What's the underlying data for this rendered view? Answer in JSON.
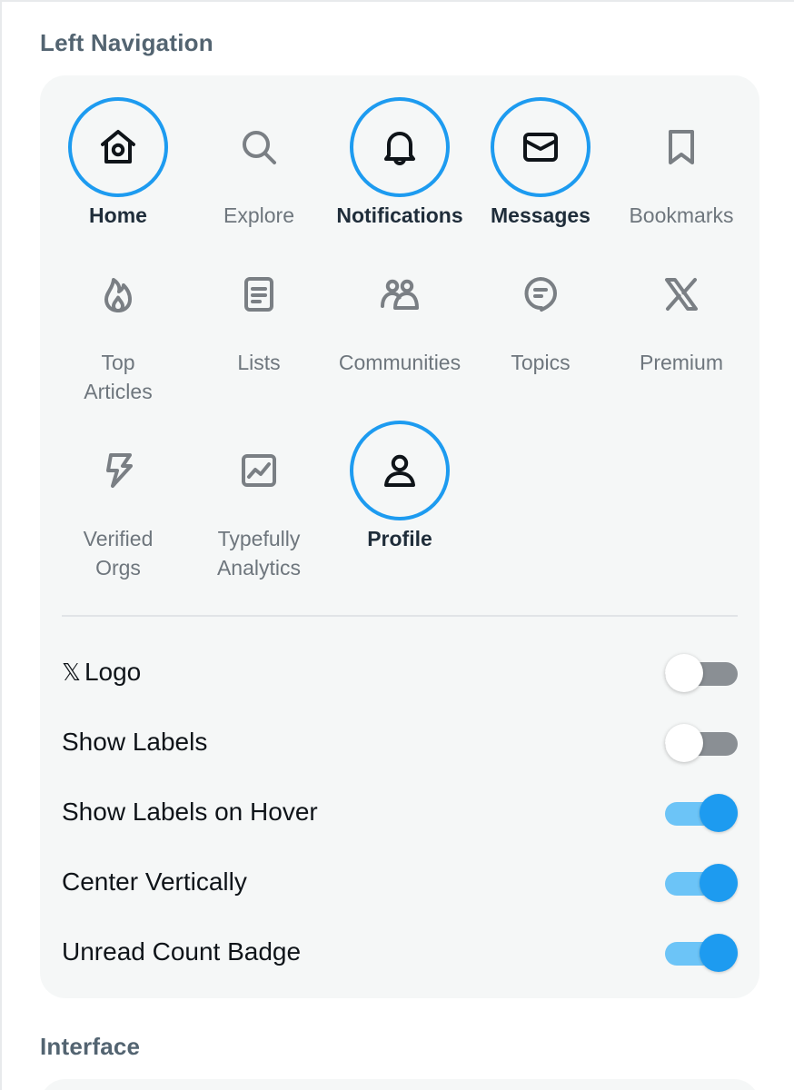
{
  "sections": {
    "left_navigation": "Left Navigation",
    "interface": "Interface"
  },
  "accent_color": "#1d9bf0",
  "nav_items": [
    {
      "label": "Home",
      "icon": "home-icon",
      "active": true
    },
    {
      "label": "Explore",
      "icon": "search-icon",
      "active": false
    },
    {
      "label": "Notifications",
      "icon": "bell-icon",
      "active": true
    },
    {
      "label": "Messages",
      "icon": "envelope-icon",
      "active": true
    },
    {
      "label": "Bookmarks",
      "icon": "bookmark-icon",
      "active": false
    },
    {
      "label": "Top Articles",
      "icon": "flame-icon",
      "active": false
    },
    {
      "label": "Lists",
      "icon": "list-icon",
      "active": false
    },
    {
      "label": "Communities",
      "icon": "people-icon",
      "active": false
    },
    {
      "label": "Topics",
      "icon": "topic-bubble-icon",
      "active": false
    },
    {
      "label": "Premium",
      "icon": "x-logo-icon",
      "active": false
    },
    {
      "label": "Verified Orgs",
      "icon": "lightning-icon",
      "active": false
    },
    {
      "label": "Typefully Analytics",
      "icon": "chart-icon",
      "active": false
    },
    {
      "label": "Profile",
      "icon": "person-icon",
      "active": true
    }
  ],
  "settings": [
    {
      "label": "Logo",
      "prefix_glyph": "𝕏",
      "enabled": false
    },
    {
      "label": "Show Labels",
      "enabled": false
    },
    {
      "label": "Show Labels on Hover",
      "enabled": true
    },
    {
      "label": "Center Vertically",
      "enabled": true
    },
    {
      "label": "Unread Count Badge",
      "enabled": true
    }
  ]
}
